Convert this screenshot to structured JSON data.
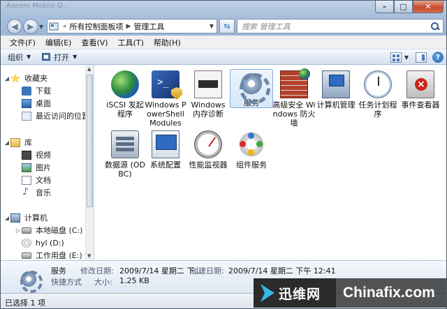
{
  "window": {
    "ghost_title": "Aseem Mobile D...",
    "controls": {
      "minimize": "–",
      "maximize": "□",
      "close": "✕"
    }
  },
  "address": {
    "crumbs": [
      "所有控制面板项",
      "管理工具"
    ],
    "search_placeholder": "搜索 管理工具"
  },
  "menu": [
    "文件(F)",
    "编辑(E)",
    "查看(V)",
    "工具(T)",
    "帮助(H)"
  ],
  "command": {
    "organize": "组织",
    "open": "打开"
  },
  "nav": {
    "favorites": {
      "title": "收藏夹",
      "items": [
        "下载",
        "桌面",
        "最近访问的位置"
      ]
    },
    "libraries": {
      "title": "库",
      "items": [
        "视频",
        "图片",
        "文档",
        "音乐"
      ]
    },
    "computer": {
      "title": "计算机",
      "items": [
        "本地磁盘 (C:)",
        "hyl (D:)",
        "工作用盘 (E:)"
      ]
    }
  },
  "items": [
    {
      "label": "iSCSI 发起程序",
      "icon": "iscsi-globe-icon"
    },
    {
      "label": "Windows PowerShell Modules",
      "icon": "powershell-icon"
    },
    {
      "label": "Windows 内存诊断",
      "icon": "memory-chip-icon"
    },
    {
      "label": "服务",
      "icon": "services-gear-icon",
      "selected": true
    },
    {
      "label": "高级安全 Windows 防火墙",
      "icon": "firewall-icon"
    },
    {
      "label": "计算机管理",
      "icon": "computer-management-icon"
    },
    {
      "label": "任务计划程序",
      "icon": "task-scheduler-clock-icon"
    },
    {
      "label": "事件查看器",
      "icon": "event-viewer-icon"
    },
    {
      "label": "数据源 (ODBC)",
      "icon": "odbc-icon"
    },
    {
      "label": "系统配置",
      "icon": "system-config-icon"
    },
    {
      "label": "性能监视器",
      "icon": "performance-monitor-icon"
    },
    {
      "label": "组件服务",
      "icon": "component-services-icon"
    }
  ],
  "details": {
    "name": "服务",
    "type": "快捷方式",
    "modified_label": "修改日期:",
    "modified_value": "2009/7/14 星期二 下...",
    "created_label": "创建日期:",
    "created_value": "2009/7/14 星期二 下午 12:41",
    "size_label": "大小:",
    "size_value": "1.25 KB"
  },
  "status": {
    "text": "已选择 1 项"
  },
  "watermark": {
    "cn": "迅维网",
    "en": "Chinafix.com"
  }
}
